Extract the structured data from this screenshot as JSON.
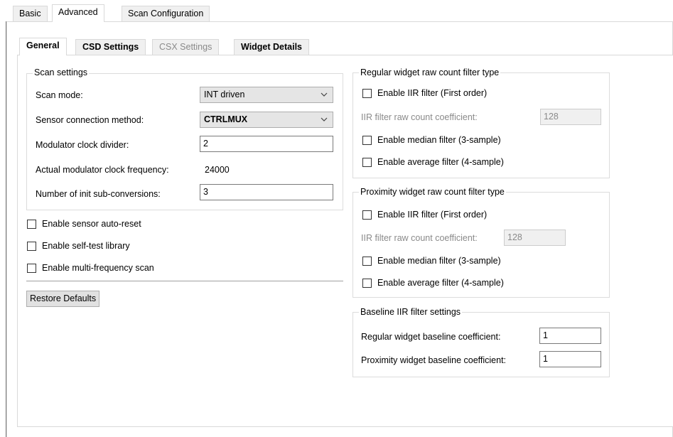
{
  "outer_tabs": [
    "Basic",
    "Advanced",
    "Scan Configuration"
  ],
  "inner_tabs": [
    "General",
    "CSD Settings",
    "CSX Settings",
    "Widget Details"
  ],
  "scan_settings": {
    "title": "Scan settings",
    "scan_mode_label": "Scan mode:",
    "scan_mode_value": "INT driven",
    "sensor_connection_label": "Sensor connection method:",
    "sensor_connection_value": "CTRLMUX",
    "mod_clk_divider_label": "Modulator clock divider:",
    "mod_clk_divider_value": "2",
    "actual_mod_clk_label": "Actual modulator clock frequency:",
    "actual_mod_clk_value": "24000",
    "init_subconv_label": "Number of init sub-conversions:",
    "init_subconv_value": "3"
  },
  "checkboxes": {
    "auto_reset": "Enable sensor auto-reset",
    "self_test": "Enable self-test library",
    "multi_freq": "Enable multi-frequency scan"
  },
  "restore_defaults": "Restore Defaults",
  "regular_filter": {
    "title": "Regular widget raw count filter type",
    "iir": "Enable IIR filter (First order)",
    "coef_label": "IIR filter raw count coefficient:",
    "coef_value": "128",
    "median": "Enable median filter (3-sample)",
    "average": "Enable average filter (4-sample)"
  },
  "proximity_filter": {
    "title": "Proximity widget raw count filter type",
    "iir": "Enable IIR filter (First order)",
    "coef_label": "IIR filter raw count coefficient:",
    "coef_value": "128",
    "median": "Enable median filter (3-sample)",
    "average": "Enable average filter (4-sample)"
  },
  "baseline": {
    "title": "Baseline IIR filter settings",
    "regular_label": "Regular widget baseline coefficient:",
    "regular_value": "1",
    "proximity_label": "Proximity widget baseline coefficient:",
    "proximity_value": "1"
  },
  "icons": {
    "dropdown": "chevron-down-icon"
  }
}
